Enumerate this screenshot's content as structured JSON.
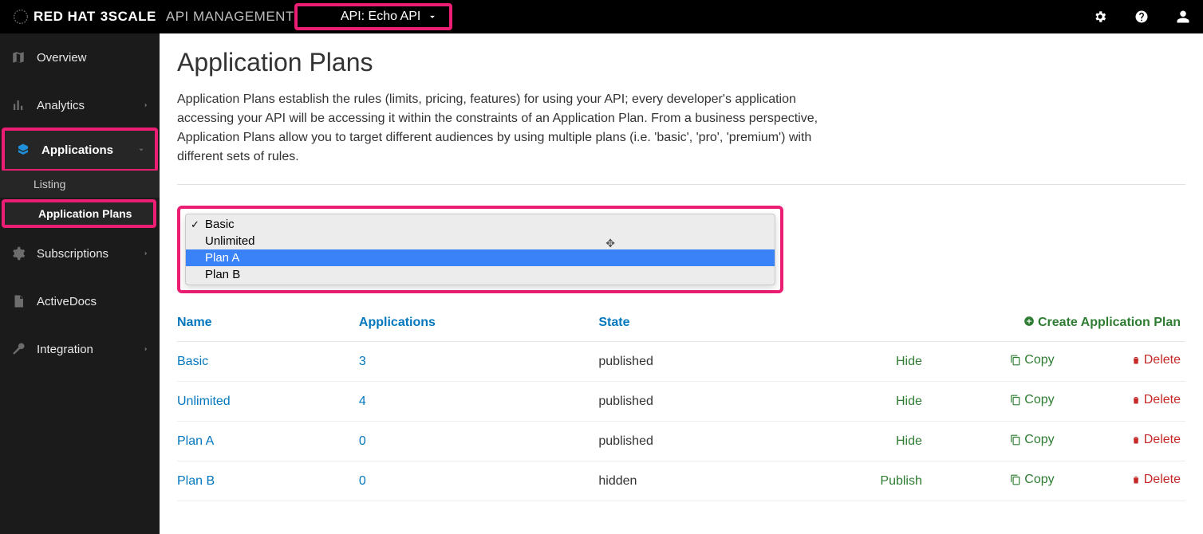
{
  "brand": {
    "vendor": "RED HAT",
    "product": "3SCALE",
    "suffix": "API MANAGEMENT"
  },
  "api_selector": {
    "label": "API: Echo API"
  },
  "sidebar": {
    "items": [
      {
        "label": "Overview",
        "icon": "map"
      },
      {
        "label": "Analytics",
        "icon": "bars",
        "caret": true
      },
      {
        "label": "Applications",
        "icon": "cubes",
        "caret": true,
        "active": true,
        "children": [
          {
            "label": "Listing"
          },
          {
            "label": "Application Plans",
            "active": true
          }
        ]
      },
      {
        "label": "Subscriptions",
        "icon": "gears",
        "caret": true
      },
      {
        "label": "ActiveDocs",
        "icon": "file"
      },
      {
        "label": "Integration",
        "icon": "wrench",
        "caret": true
      }
    ]
  },
  "page": {
    "title": "Application Plans",
    "description": "Application Plans establish the rules (limits, pricing, features) for using your API; every developer's application accessing your API will be accessing it within the constraints of an Application Plan. From a business perspective, Application Plans allow you to target different audiences by using multiple plans (i.e. 'basic', 'pro', 'premium') with different sets of rules."
  },
  "default_plan_select": {
    "options": [
      {
        "label": "Basic",
        "selected": true
      },
      {
        "label": "Unlimited"
      },
      {
        "label": "Plan A",
        "hover": true
      },
      {
        "label": "Plan B"
      }
    ]
  },
  "table": {
    "headers": {
      "name": "Name",
      "apps": "Applications",
      "state": "State",
      "create": "Create Application Plan"
    },
    "actions": {
      "hide": "Hide",
      "publish": "Publish",
      "copy": "Copy",
      "delete": "Delete"
    },
    "rows": [
      {
        "name": "Basic",
        "apps": "3",
        "state": "published",
        "toggle": "hide"
      },
      {
        "name": "Unlimited",
        "apps": "4",
        "state": "published",
        "toggle": "hide"
      },
      {
        "name": "Plan A",
        "apps": "0",
        "state": "published",
        "toggle": "hide"
      },
      {
        "name": "Plan B",
        "apps": "0",
        "state": "hidden",
        "toggle": "publish"
      }
    ]
  }
}
